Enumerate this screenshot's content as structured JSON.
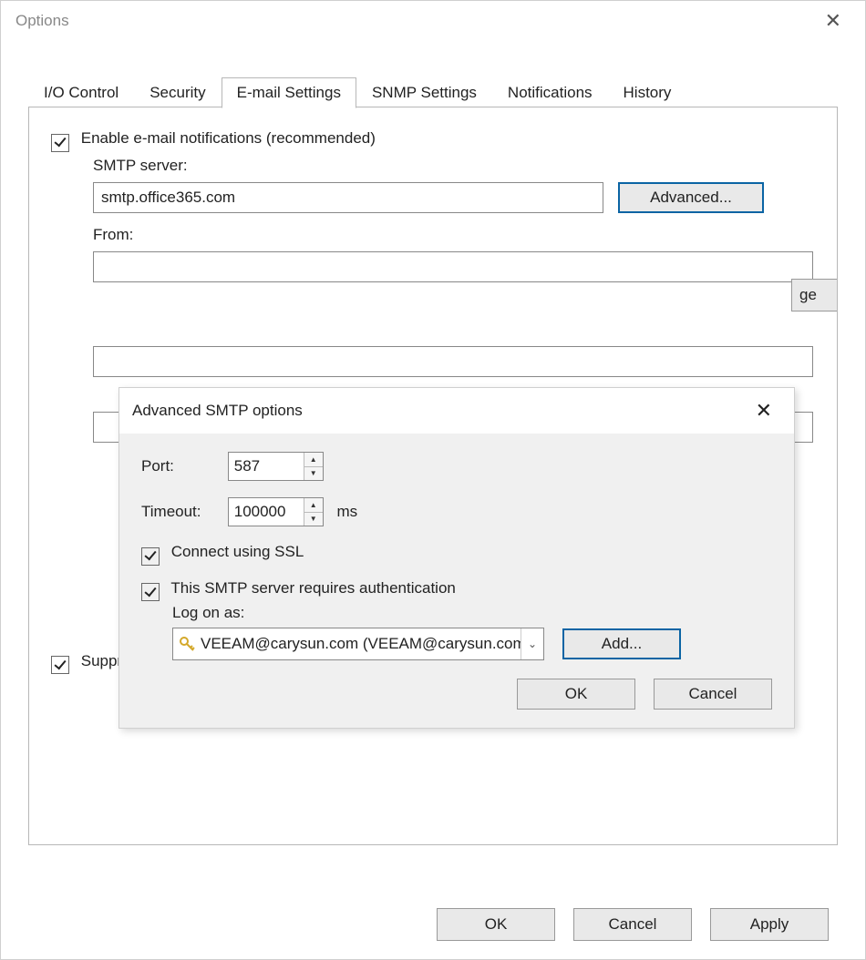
{
  "window": {
    "title": "Options"
  },
  "tabs": [
    "I/O Control",
    "Security",
    "E-mail Settings",
    "SNMP Settings",
    "Notifications",
    "History"
  ],
  "active_tab_index": 2,
  "email": {
    "enable_label": "Enable e-mail notifications (recommended)",
    "enable_checked": true,
    "smtp_label": "SMTP server:",
    "smtp_value": "smtp.office365.com",
    "advanced_btn": "Advanced...",
    "from_label": "From:",
    "from_value": "",
    "suppress_label": "Suppress notifications until the last job retry",
    "suppress_checked": true,
    "partial_button_text": "ge"
  },
  "modal": {
    "title": "Advanced SMTP options",
    "port_label": "Port:",
    "port_value": "587",
    "timeout_label": "Timeout:",
    "timeout_value": "100000",
    "timeout_unit": "ms",
    "ssl_label": "Connect using SSL",
    "ssl_checked": true,
    "auth_label": "This SMTP server requires authentication",
    "auth_checked": true,
    "logon_label": "Log on as:",
    "logon_value": "VEEAM@carysun.com (VEEAM@carysun.com",
    "add_btn": "Add...",
    "ok_btn": "OK",
    "cancel_btn": "Cancel"
  },
  "buttons": {
    "ok": "OK",
    "cancel": "Cancel",
    "apply": "Apply"
  }
}
